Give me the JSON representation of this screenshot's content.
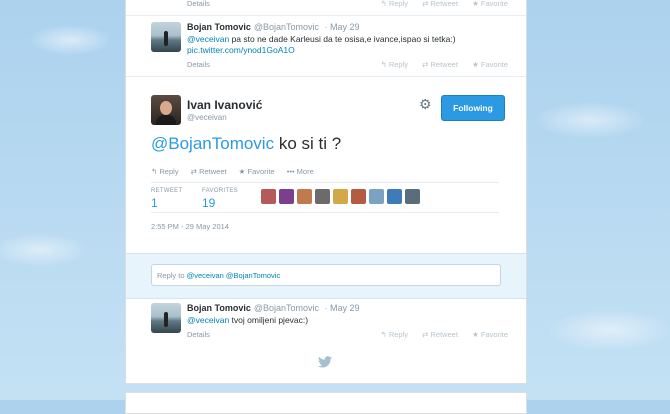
{
  "top_fragment": {
    "details": "Details",
    "actions": [
      "Reply",
      "Retweet",
      "Favorite"
    ]
  },
  "reply_tweet_1": {
    "name": "Bojan Tomovic",
    "handle": "@BojanTomovic",
    "time": "· May 29",
    "mention": "@veceivan",
    "text": "pa sto ne dade Karleusi da te osisa,e ivance,ispao si tetka:)",
    "link": "pic.twitter.com/ynod1GoA1O",
    "details": "Details",
    "actions": [
      "Reply",
      "Retweet",
      "Favorite"
    ]
  },
  "main_tweet": {
    "name": "Ivan Ivanović",
    "handle": "@veceivan",
    "follow_label": "Following",
    "mention": "@BojanTomovic",
    "text": "ko si ti ?",
    "actions": {
      "reply": "Reply",
      "retweet": "Retweet",
      "favorite": "Favorite",
      "more": "More"
    },
    "stats": {
      "retweet_label": "RETWEET",
      "retweet_count": "1",
      "favorites_label": "FAVORITES",
      "favorites_count": "19"
    },
    "favoriter_colors": [
      "#b55a5a",
      "#7c3f8c",
      "#c07a4d",
      "#6b6b6b",
      "#d3a84a",
      "#b55b42",
      "#7aa3c2",
      "#3e7bb8",
      "#5a6d7a"
    ],
    "timestamp": "2:55 PM - 29 May 2014"
  },
  "reply_box": {
    "prefix": "Reply to ",
    "mention1": "@veceivan",
    "mention2": "@BojanTomovic"
  },
  "reply_tweet_2": {
    "name": "Bojan Tomovic",
    "handle": "@BojanTomovic",
    "time": "· May 29",
    "mention": "@veceivan",
    "text": "tvoj omiljeni pjevac:)",
    "details": "Details",
    "actions": [
      "Reply",
      "Retweet",
      "Favorite"
    ]
  },
  "colors": {
    "accent": "#2b9ae3",
    "link": "#0084b4",
    "muted": "#8899a6",
    "reply_bg": "#e8f4fb"
  }
}
